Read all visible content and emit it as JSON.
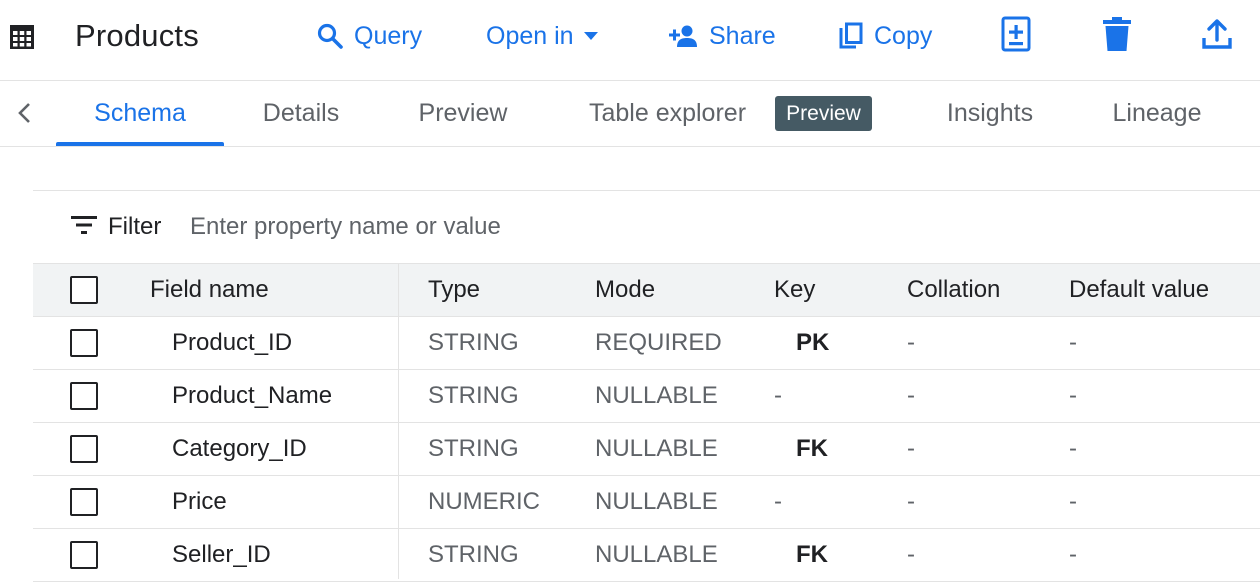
{
  "toolbar": {
    "title": "Products",
    "query_label": "Query",
    "open_in_label": "Open in",
    "share_label": "Share",
    "copy_label": "Copy",
    "accent_color": "#1a73e8"
  },
  "tabs": [
    {
      "label": "Schema",
      "active": true
    },
    {
      "label": "Details"
    },
    {
      "label": "Preview"
    },
    {
      "label": "Table explorer"
    },
    {
      "label": "Insights"
    },
    {
      "label": "Lineage"
    }
  ],
  "badge": {
    "label": "Preview",
    "color": "#455a64"
  },
  "filter": {
    "label": "Filter",
    "placeholder": "Enter property name or value"
  },
  "table": {
    "headers": {
      "field_name": "Field name",
      "type": "Type",
      "mode": "Mode",
      "key": "Key",
      "collation": "Collation",
      "default_value": "Default value"
    },
    "rows": [
      {
        "field_name": "Product_ID",
        "type": "STRING",
        "mode": "REQUIRED",
        "key": "PK",
        "collation": "-",
        "default_value": "-"
      },
      {
        "field_name": "Product_Name",
        "type": "STRING",
        "mode": "NULLABLE",
        "key": "-",
        "collation": "-",
        "default_value": "-"
      },
      {
        "field_name": "Category_ID",
        "type": "STRING",
        "mode": "NULLABLE",
        "key": "FK",
        "collation": "-",
        "default_value": "-"
      },
      {
        "field_name": "Price",
        "type": "NUMERIC",
        "mode": "NULLABLE",
        "key": "-",
        "collation": "-",
        "default_value": "-"
      },
      {
        "field_name": "Seller_ID",
        "type": "STRING",
        "mode": "NULLABLE",
        "key": "FK",
        "collation": "-",
        "default_value": "-"
      }
    ]
  }
}
